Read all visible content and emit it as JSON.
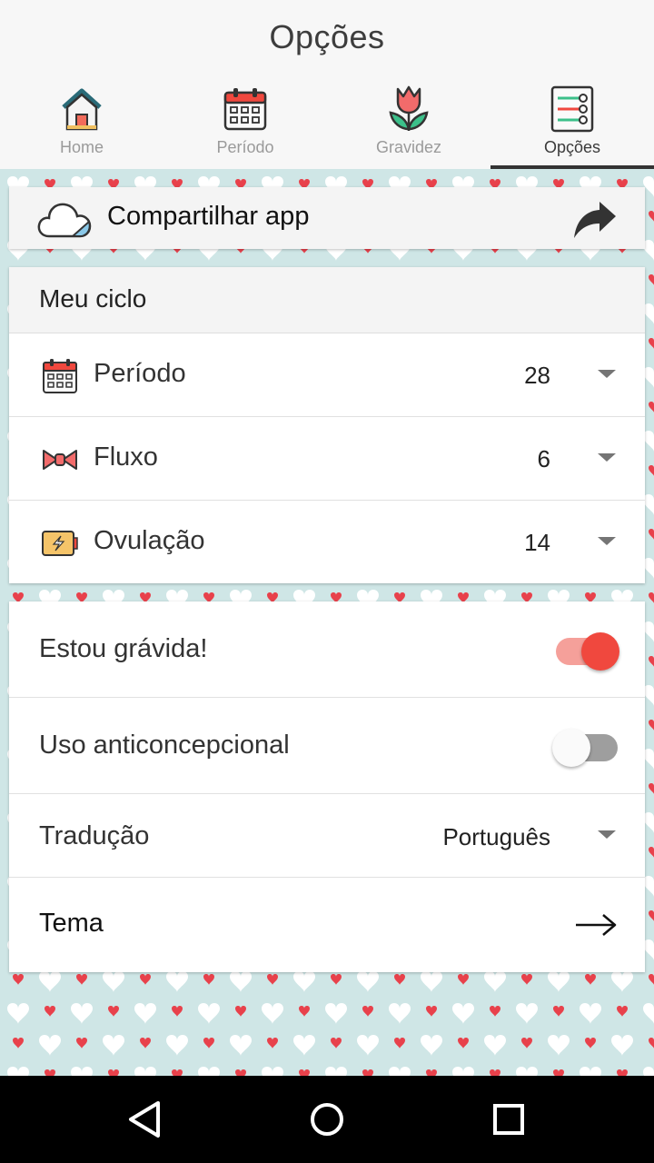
{
  "header": {
    "title": "Opções",
    "tabs": [
      {
        "label": "Home",
        "icon": "house-icon",
        "active": false
      },
      {
        "label": "Período",
        "icon": "calendar-icon",
        "active": false
      },
      {
        "label": "Gravidez",
        "icon": "tulip-icon",
        "active": false
      },
      {
        "label": "Opções",
        "icon": "settings-list-icon",
        "active": true
      }
    ]
  },
  "share": {
    "label": "Compartilhar app",
    "icon": "cloud-icon",
    "action_icon": "share-arrow-icon"
  },
  "cycle": {
    "title": "Meu ciclo",
    "rows": [
      {
        "label": "Período",
        "value": "28",
        "icon": "calendar-icon"
      },
      {
        "label": "Fluxo",
        "value": "6",
        "icon": "bow-icon"
      },
      {
        "label": "Ovulação",
        "value": "14",
        "icon": "battery-icon"
      }
    ]
  },
  "settings": {
    "pregnant": {
      "label": "Estou grávida!",
      "on": true
    },
    "contraceptive": {
      "label": "Uso anticoncepcional",
      "on": false
    },
    "translation": {
      "label": "Tradução",
      "value": "Português"
    },
    "theme": {
      "label": "Tema",
      "icon": "arrow-right-icon"
    }
  },
  "colors": {
    "accent": "#f0483e",
    "accent_light": "#f5a09a",
    "pattern_bg": "#cfe6e6",
    "heart_red": "#e8414b"
  },
  "navbar": {
    "back_icon": "back-triangle-icon",
    "home_icon": "home-circle-icon",
    "recents_icon": "recents-square-icon"
  }
}
